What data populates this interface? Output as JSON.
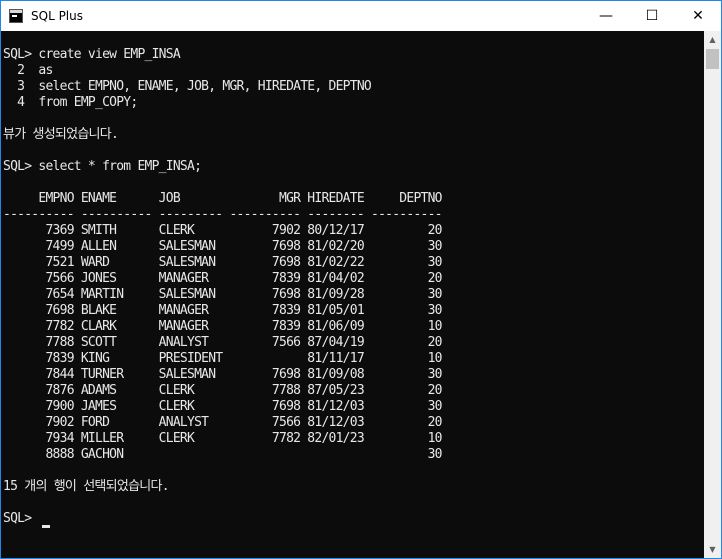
{
  "window": {
    "title": "SQL Plus",
    "buttons": {
      "minimize": "—",
      "maximize": "☐",
      "close": "✕"
    }
  },
  "console": {
    "lines": [
      "SQL> create view EMP_INSA",
      "  2  as",
      "  3  select EMPNO, ENAME, JOB, MGR, HIREDATE, DEPTNO",
      "  4  from EMP_COPY;",
      "",
      "뷰가 생성되었습니다.",
      "",
      "SQL> select * from EMP_INSA;",
      "",
      "     EMPNO ENAME      JOB              MGR HIREDATE     DEPTNO",
      "---------- ---------- --------- ---------- -------- ----------",
      "      7369 SMITH      CLERK           7902 80/12/17         20",
      "      7499 ALLEN      SALESMAN        7698 81/02/20         30",
      "      7521 WARD       SALESMAN        7698 81/02/22         30",
      "      7566 JONES      MANAGER         7839 81/04/02         20",
      "      7654 MARTIN     SALESMAN        7698 81/09/28         30",
      "      7698 BLAKE      MANAGER         7839 81/05/01         30",
      "      7782 CLARK      MANAGER         7839 81/06/09         10",
      "      7788 SCOTT      ANALYST         7566 87/04/19         20",
      "      7839 KING       PRESIDENT            81/11/17         10",
      "      7844 TURNER     SALESMAN        7698 81/09/08         30",
      "      7876 ADAMS      CLERK           7788 87/05/23         20",
      "      7900 JAMES      CLERK           7698 81/12/03         30",
      "      7902 FORD       ANALYST         7566 81/12/03         20",
      "      7934 MILLER     CLERK           7782 82/01/23         10",
      "      8888 GACHON                                           30",
      "",
      "15 개의 행이 선택되었습니다.",
      "",
      "SQL> "
    ]
  }
}
